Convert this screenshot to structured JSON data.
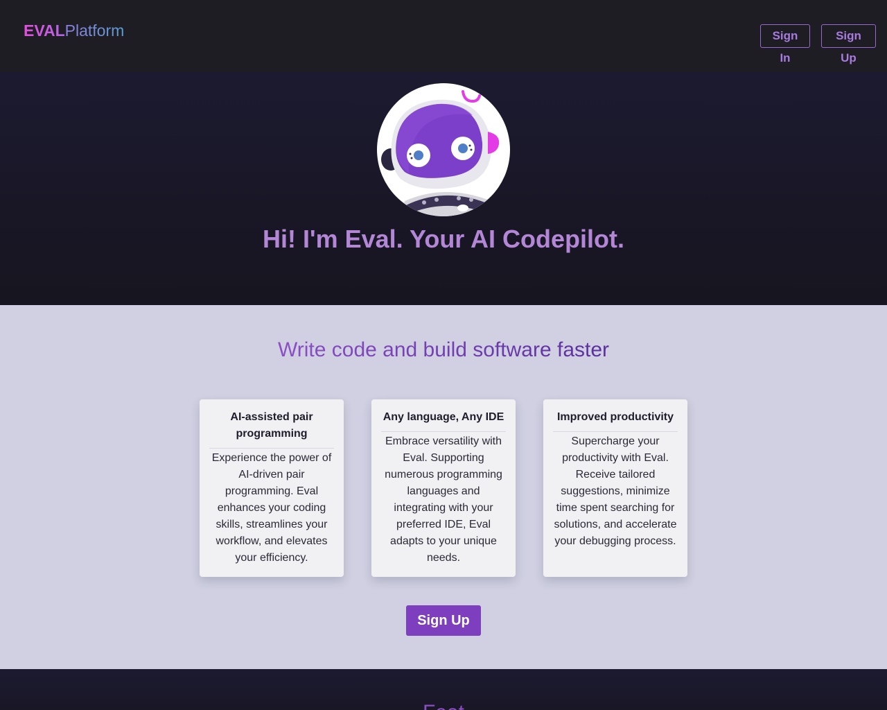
{
  "header": {
    "logo_part1": "EVAL",
    "logo_part2": "Platform",
    "sign_in_label": "Sign In",
    "sign_up_label": "Sign Up"
  },
  "hero": {
    "avatar_icon": "robot-mascot-icon",
    "title": "Hi! I'm Eval. Your AI Codepilot."
  },
  "intro": {
    "title": "Write code and build software faster",
    "cards": [
      {
        "title": "AI-assisted pair programming",
        "body": "Experience the power of AI-driven pair programming. Eval enhances your coding skills, streamlines your workflow, and elevates your efficiency."
      },
      {
        "title": "Any language, Any IDE",
        "body": "Embrace versatility with Eval. Supporting numerous programming languages and integrating with your preferred IDE, Eval adapts to your unique needs."
      },
      {
        "title": "Improved productivity",
        "body": "Supercharge your productivity with Eval. Receive tailored suggestions, minimize time spent searching for solutions, and accelerate your debugging process."
      }
    ],
    "cta_label": "Sign Up"
  },
  "footer_section": {
    "title_partial": "Feat"
  },
  "colors": {
    "header_bg": "#1e1d24",
    "hero_bg": "#1c1a30",
    "accent": "#7d3fbe",
    "hero_title": "#b387d6",
    "section_bg": "#d0d0e2",
    "card_bg": "#f1f1f4"
  }
}
